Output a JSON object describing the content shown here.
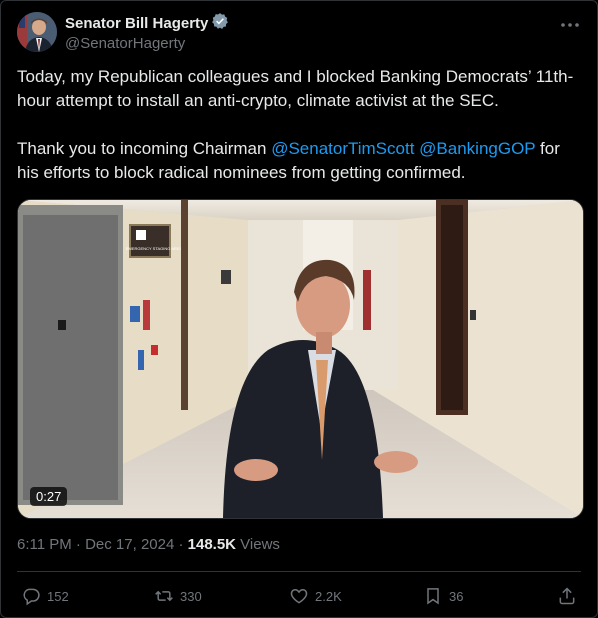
{
  "author": {
    "display_name": "Senator Bill Hagerty",
    "handle": "@SenatorHagerty",
    "verified_icon": "verified-badge-icon"
  },
  "tweet": {
    "text_part1": "Today, my Republican colleagues and I blocked Banking Democrats’ 11th-hour attempt to install an anti-crypto, climate activist at the SEC.\n\nThank you to incoming Chairman ",
    "mention1": "@SenatorTimScott",
    "space": " ",
    "mention2": "@BankingGOP",
    "text_part2": " for his efforts to block radical nominees from getting confirmed."
  },
  "media": {
    "duration": "0:27",
    "sign_text": "EMERGENCY STAGING AREA"
  },
  "meta": {
    "timestamp": "6:11 PM · Dec 17, 2024 · ",
    "views_count": "148.5K",
    "views_label": " Views"
  },
  "actions": {
    "replies": "152",
    "reposts": "330",
    "likes": "2.2K",
    "bookmarks": "36"
  },
  "colors": {
    "accent": "#1d9bf0",
    "muted": "#71767b",
    "text": "#e7e9ea",
    "verified": "#829aab"
  }
}
